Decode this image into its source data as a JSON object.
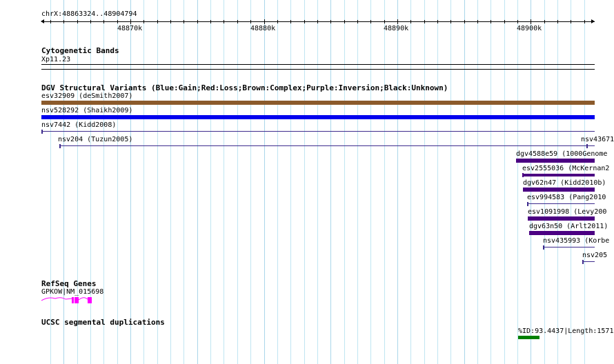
{
  "position_label": "chrX:48863324..48904794",
  "ruler": {
    "start": 48863324,
    "end": 48904794,
    "labels": [
      "48870k",
      "48880k",
      "48890k",
      "48900k"
    ]
  },
  "cytoband": {
    "title": "Cytogenetic Bands",
    "band": "Xp11.23"
  },
  "dgv": {
    "title": "DGV Structural Variants (Blue:Gain;Red:Loss;Brown:Complex;Purple:Inversion;Black:Unknown)",
    "colors": {
      "brown": "#8b5a2b",
      "blue": "#0000ee",
      "purple": "#4b0082",
      "purple_thin": "#3d2a8c"
    },
    "features": [
      {
        "label": "esv32909 (deSmith2007)",
        "start": 48863324,
        "end": 48904794,
        "style": "thick",
        "color": "brown"
      },
      {
        "label": "nsv528292 (Shaikh2009)",
        "start": 48863324,
        "end": 48904794,
        "style": "thick",
        "color": "blue"
      },
      {
        "label": "nsv7442 (Kidd2008)",
        "start": 48863324,
        "end": 48904794,
        "style": "line",
        "color": "purple_thin"
      },
      {
        "label": "nsv204 (Tuzun2005)",
        "start": 48864650,
        "end": 48904794,
        "style": "line",
        "color": "purple_thin"
      },
      {
        "label": "nsv43671",
        "start": 48904180,
        "end": 48904794,
        "style": "line",
        "color": "purple_thin"
      },
      {
        "label": "dgv4588e59 (1000Genome",
        "start": 48898900,
        "end": 48904794,
        "style": "thick",
        "color": "purple"
      },
      {
        "label": "esv2555036 (McKernan2",
        "start": 48899350,
        "end": 48904794,
        "style": "line-thick",
        "color": "purple"
      },
      {
        "label": "dgv62n47 (Kidd2010b)",
        "start": 48899400,
        "end": 48904794,
        "style": "thick",
        "color": "purple"
      },
      {
        "label": "esv994583 (Pang2010",
        "start": 48899750,
        "end": 48904794,
        "style": "line",
        "color": "purple_thin"
      },
      {
        "label": "esv1091998 (Levy200",
        "start": 48899800,
        "end": 48904794,
        "style": "thick",
        "color": "purple"
      },
      {
        "label": "dgv63n50 (Arlt2011)",
        "start": 48899900,
        "end": 48904794,
        "style": "thick",
        "color": "purple"
      },
      {
        "label": "nsv435993 (Korbe",
        "start": 48900900,
        "end": 48904794,
        "style": "line",
        "color": "purple_thin"
      },
      {
        "label": "nsv205",
        "start": 48903850,
        "end": 48904794,
        "style": "line",
        "color": "purple_thin"
      }
    ]
  },
  "refseq": {
    "title": "RefSeq Genes",
    "gene_label": "GPKOW|NM_015698",
    "color": "#ff00ff"
  },
  "segdup": {
    "title": "UCSC segmental duplications",
    "label": "%ID:93.4437|Length:1571",
    "color": "#008000"
  }
}
